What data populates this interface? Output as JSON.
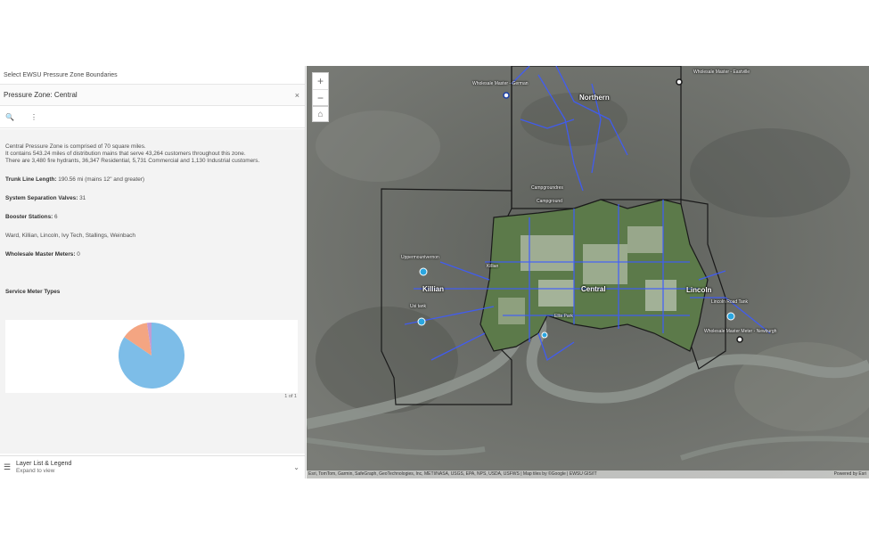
{
  "panel": {
    "heading": "Select EWSU Pressure Zone Boundaries",
    "zone_title": "Pressure Zone: Central",
    "close_glyph": "×",
    "tools": {
      "zoom_icon": "🔍",
      "more_icon": "⋮"
    }
  },
  "popup": {
    "description_lines": [
      "Central Pressure Zone is comprised of 70 square miles.",
      "It contains 543.24 miles of distribution mains that serve 43,264 customers throughout this zone.",
      "There are 3,480 fire hydrants, 36,347 Residential, 5,731 Commercial and 1,130 Industrial customers."
    ],
    "trunk_label": "Trunk Line Length:",
    "trunk_value": "190.56 mi (mains 12\" and greater)",
    "valves_label": "System Separation Valves:",
    "valves_value": "31",
    "booster_label": "Booster Stations:",
    "booster_value": "6",
    "booster_list": "Ward, Killian, Lincoln, Ivy Tech, Stallings, Weinbach",
    "wholesale_label": "Wholesale Master Meters:",
    "wholesale_value": "0",
    "chart_section_title": "Service Meter Types",
    "pager": "1 of 1"
  },
  "chart_data": {
    "type": "pie",
    "title": "Service Meter Types",
    "slices": [
      {
        "value": 84.5,
        "color": "#7dbde8"
      },
      {
        "value": 13.3,
        "color": "#f4a582"
      },
      {
        "value": 2.2,
        "color": "#c39bd3"
      }
    ]
  },
  "legend_bar": {
    "icon": "☰",
    "title": "Layer List & Legend",
    "subtitle": "Expand to view",
    "chevron": "⌄"
  },
  "map": {
    "zoom_in": "+",
    "zoom_out": "−",
    "home_icon": "⌂",
    "labels": {
      "northern": "Northern",
      "killian": "Killian",
      "central": "Central",
      "lincoln": "Lincoln",
      "wholesale_german": "Wholesale Master - German",
      "campgroundres": "Campgroundres",
      "campground": "Campground",
      "uppermountvernon": "Uppermountvernon",
      "killian_small": "Killian",
      "usi_tank": "Usi tank",
      "ellis_park": "Ellis Park",
      "lincoln_tank": "Lincoln Road Tank",
      "wholesale_newburgh": "Wholesale Master Meter - Newburgh",
      "wholesale_eastville": "Wholesale Master - Eastville"
    },
    "attribution": "Esri, TomTom, Garmin, SafeGraph, GeoTechnologies, Inc, METI/NASA, USGS, EPA, NPS, USDA, USFWS | Map tiles by ©Google | EWSU GIS/IT",
    "powered_by": "Powered by Esri",
    "colors": {
      "mains": "#3d5bff",
      "boundary": "#1a1a1a",
      "river": "#8e948e"
    }
  }
}
